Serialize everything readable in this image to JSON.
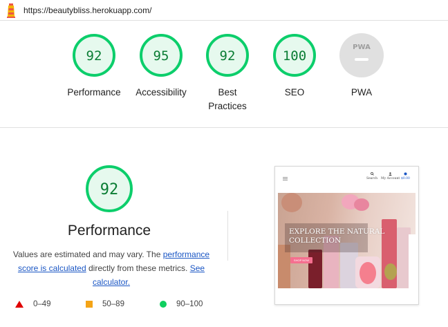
{
  "url_bar": {
    "url": "https://beautybliss.herokuapp.com/"
  },
  "colors": {
    "pass": "#0cce6b",
    "pass_text": "#0a7d34",
    "average": "#f4a416",
    "fail": "#e00000",
    "na": "#e0e0e0",
    "link": "#1a56c4"
  },
  "categories": [
    {
      "score": "92",
      "label": "Performance"
    },
    {
      "score": "95",
      "label": "Accessibility"
    },
    {
      "score": "92",
      "label": "Best Practices"
    },
    {
      "score": "100",
      "label": "SEO"
    },
    {
      "badge": "PWA",
      "label": "PWA"
    }
  ],
  "performance": {
    "score": "92",
    "title": "Performance",
    "desc_prefix": "Values are estimated and may vary. The ",
    "desc_link1": "performance score is calculated",
    "desc_middle": " directly from these metrics. ",
    "desc_link2": "See calculator."
  },
  "legend": [
    {
      "icon": "red-triangle",
      "range": "0–49"
    },
    {
      "icon": "orange-square",
      "range": "50–89"
    },
    {
      "icon": "green-circle",
      "range": "90–100"
    }
  ],
  "screenshot": {
    "nav": {
      "search": "Search",
      "account": "My Account",
      "cart": "$0.00"
    },
    "hero_text": "EXPLORE THE NATURAL COLLECTION",
    "hero_button": "SHOP NOW"
  }
}
